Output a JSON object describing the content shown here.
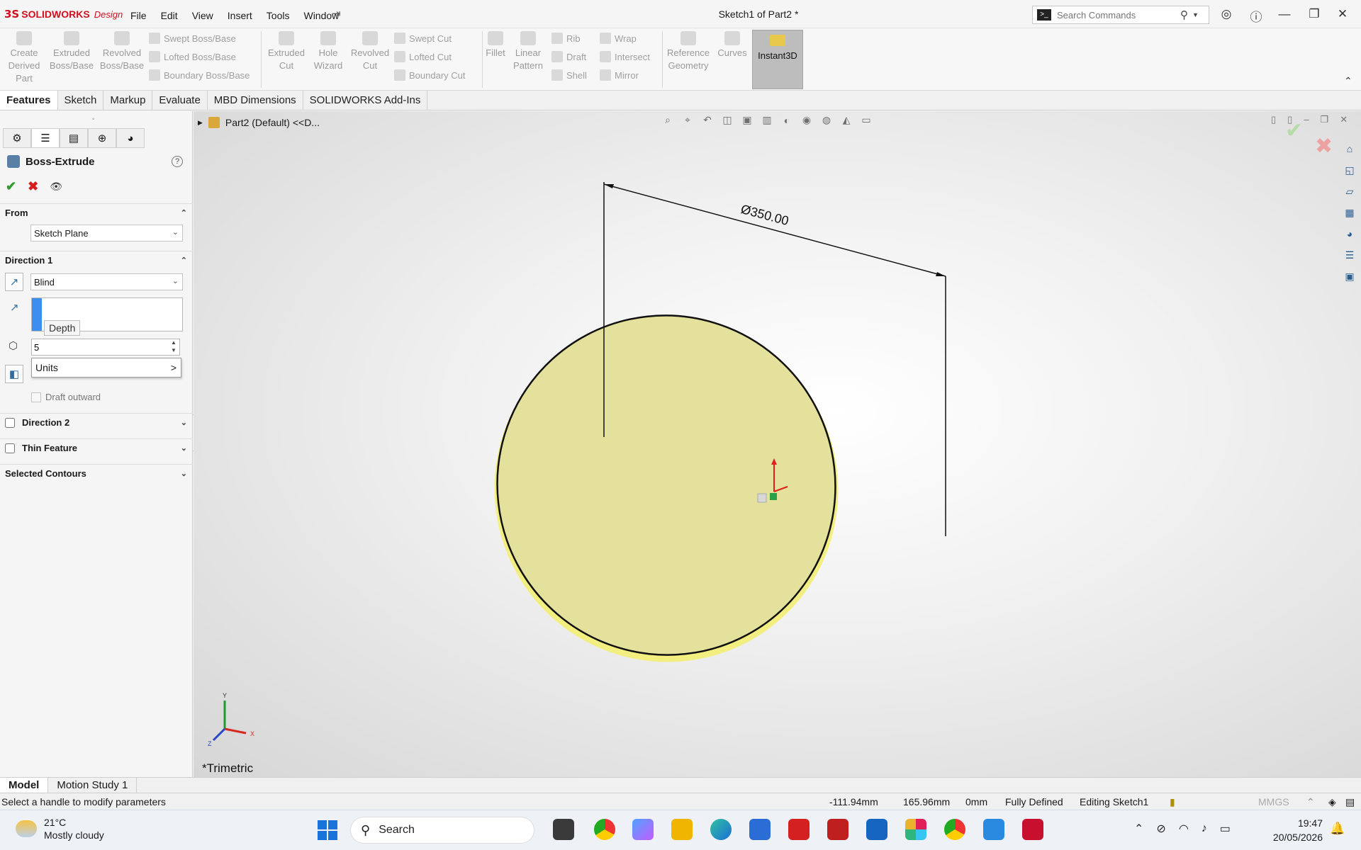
{
  "app": {
    "brand": "SOLIDWORKS",
    "brand_suffix": "Design",
    "doc_title": "Sketch1 of Part2 *"
  },
  "menu": [
    "File",
    "Edit",
    "View",
    "Insert",
    "Tools",
    "Window"
  ],
  "search": {
    "placeholder": "Search Commands"
  },
  "commands": {
    "create_derived": [
      "Create",
      "Derived",
      "Part"
    ],
    "extruded_boss": [
      "Extruded",
      "Boss/Base"
    ],
    "revolved_boss": [
      "Revolved",
      "Boss/Base"
    ],
    "swept_boss": "Swept Boss/Base",
    "lofted_boss": "Lofted Boss/Base",
    "boundary_boss": "Boundary Boss/Base",
    "extruded_cut": [
      "Extruded",
      "Cut"
    ],
    "hole_wizard": [
      "Hole",
      "Wizard"
    ],
    "revolved_cut": [
      "Revolved",
      "Cut"
    ],
    "swept_cut": "Swept Cut",
    "lofted_cut": "Lofted Cut",
    "boundary_cut": "Boundary Cut",
    "fillet": "Fillet",
    "linear_pattern": [
      "Linear",
      "Pattern"
    ],
    "rib": "Rib",
    "draft": "Draft",
    "shell": "Shell",
    "wrap": "Wrap",
    "intersect": "Intersect",
    "mirror": "Mirror",
    "reference_geometry": [
      "Reference",
      "Geometry"
    ],
    "curves": "Curves",
    "instant3d": "Instant3D"
  },
  "tabs": [
    "Features",
    "Sketch",
    "Markup",
    "Evaluate",
    "MBD Dimensions",
    "SOLIDWORKS Add-Ins"
  ],
  "property_manager": {
    "title": "Boss-Extrude",
    "from": {
      "label": "From",
      "value": "Sketch Plane"
    },
    "direction1": {
      "label": "Direction 1",
      "end_condition": "Blind",
      "depth_tooltip": "Depth",
      "depth_value": "5",
      "units_menu": "Units",
      "draft_outward": "Draft outward"
    },
    "direction2": {
      "label": "Direction 2"
    },
    "thin_feature": {
      "label": "Thin Feature"
    },
    "selected_contours": {
      "label": "Selected Contours"
    }
  },
  "viewport": {
    "tree_item": "Part2 (Default) <<D...",
    "dimension_label": "Ø350.00",
    "view_name": "*Trimetric",
    "triad_x": "X",
    "triad_y": "Y",
    "triad_z": "Z",
    "face_color": "#e4e19c",
    "edge_color": "#f2ee80"
  },
  "bottom_tabs": [
    "Model",
    "Motion Study 1"
  ],
  "status": {
    "hint": "Select a handle to modify parameters",
    "x": "-111.94mm",
    "y": "165.96mm",
    "z": "0mm",
    "state": "Fully Defined",
    "editing": "Editing Sketch1",
    "units": "MMGS"
  },
  "taskbar": {
    "temp": "21°C",
    "weather": "Mostly cloudy",
    "search": "Search",
    "time": "19:47",
    "date": "20/05/2026"
  }
}
